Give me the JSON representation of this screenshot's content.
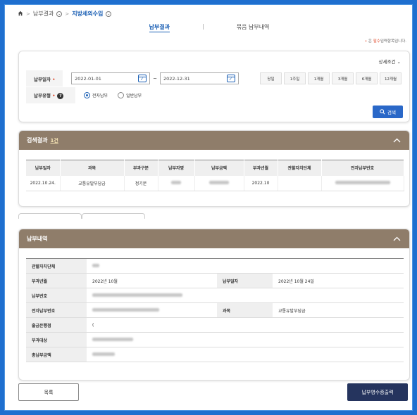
{
  "breadcrumb": {
    "level1": "납부결과",
    "level2": "지방세외수입"
  },
  "tabs": [
    {
      "label": "납부결과",
      "active": true
    },
    {
      "label": "묶음 납부내역",
      "active": false
    }
  ],
  "required_note": {
    "mark": "•",
    "prefix": "은",
    "emphasis": "필수",
    "suffix": "입력항목입니다."
  },
  "search": {
    "detail_toggle": "상세조건",
    "date_label": "납부일자",
    "date_from": "2022-01-01",
    "date_to": "2022-12-31",
    "tilde": "~",
    "periods": [
      "당일",
      "1주일",
      "1개월",
      "3개월",
      "6개월",
      "12개월"
    ],
    "type_label": "납부유형",
    "type_options": [
      {
        "label": "전자납부",
        "selected": true
      },
      {
        "label": "일반납부",
        "selected": false
      }
    ],
    "search_button": "검색"
  },
  "results": {
    "title": "검색결과",
    "count": "1건",
    "headers": [
      "납부일자",
      "과목",
      "부과구분",
      "납부자명",
      "납부금액",
      "부과년월",
      "관할자치단체",
      "전자납부번호"
    ],
    "rows": [
      {
        "date": "2022.10.24.",
        "subject": "교통유발부담금",
        "kind": "정기분",
        "payer": "",
        "amount": "",
        "period": "2022.10",
        "authority": "",
        "epay_no": ""
      }
    ]
  },
  "info": {
    "title": "납부내역",
    "fields": {
      "authority_label": "관할자치단체",
      "levy_period_label": "부과년월",
      "levy_period": "2022년 10월",
      "pay_date_label": "납부일자",
      "pay_date": "2022년 10월 24일",
      "pay_no_label": "납부번호",
      "epay_no_label": "전자납부번호",
      "subject_label": "과목",
      "subject": "교통유발부담금",
      "bank_label": "출금은행점",
      "bank": "(",
      "target_label": "부과대상",
      "total_label": "총납부금액"
    }
  },
  "buttons": {
    "list": "목록",
    "print": "납부영수증출력"
  },
  "colors": {
    "frame": "#1f6fcf",
    "accent": "#1a5fb4",
    "panel_header": "#8f7d6a",
    "print_button": "#25345e",
    "required": "#e04a2b"
  }
}
